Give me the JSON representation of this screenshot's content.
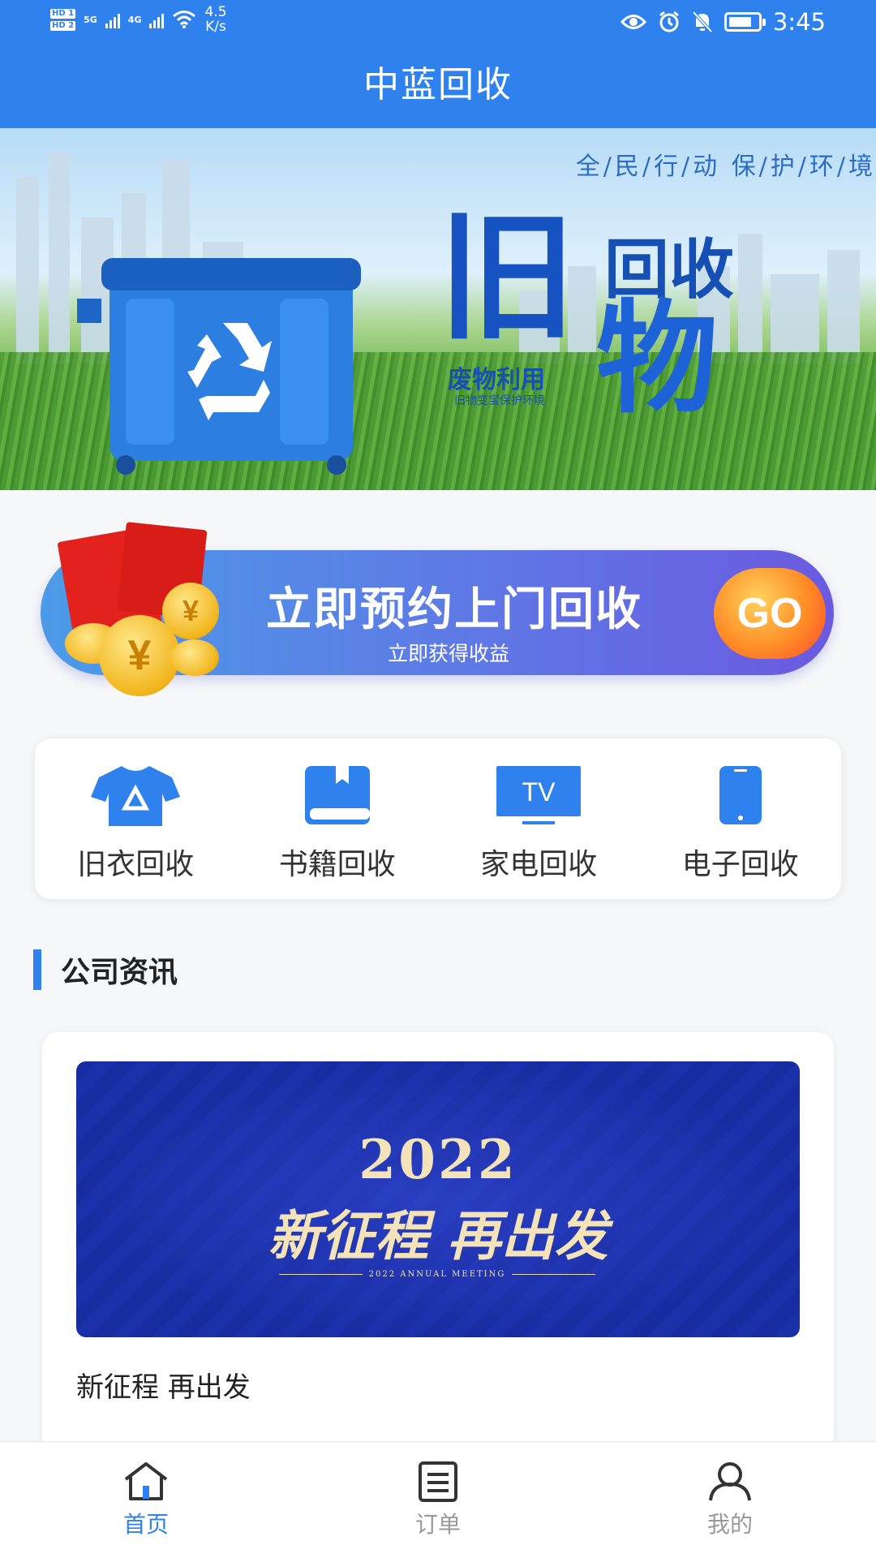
{
  "status_bar": {
    "sim1": "HD 1",
    "sim2": "HD 2",
    "net1": "5G",
    "net2": "4G",
    "speed_value": "4.5",
    "speed_unit": "K/s",
    "time": "3:45",
    "battery_level": 0.8
  },
  "header": {
    "title": "中蓝回收"
  },
  "hero": {
    "slogan": "全/民/行/动 保/护/环/境",
    "big_char": "旧",
    "line1": "回收",
    "line2": "物",
    "subtitle": "废物利用",
    "tiny": "旧物变宝保护环境"
  },
  "appointment": {
    "title": "立即预约上门回收",
    "subtitle": "立即获得收益",
    "go_label": "GO",
    "coin_symbol": "¥"
  },
  "categories": [
    {
      "label": "旧衣回收",
      "icon": "clothes-icon"
    },
    {
      "label": "书籍回收",
      "icon": "book-icon"
    },
    {
      "label": "家电回收",
      "icon": "tv-icon"
    },
    {
      "label": "电子回收",
      "icon": "phone-icon"
    }
  ],
  "tv_icon_text": "TV",
  "section": {
    "title": "公司资讯"
  },
  "news": [
    {
      "image_year": "2022",
      "image_headline": "新征程 再出发",
      "image_caption": "2022 ANNUAL MEETING",
      "title": "新征程 再出发"
    }
  ],
  "bottom_nav": [
    {
      "label": "首页",
      "icon": "home-icon",
      "active": true
    },
    {
      "label": "订单",
      "icon": "order-list-icon",
      "active": false
    },
    {
      "label": "我的",
      "icon": "user-icon",
      "active": false
    }
  ],
  "colors": {
    "primary": "#2f82ee",
    "inactive": "#999999"
  }
}
